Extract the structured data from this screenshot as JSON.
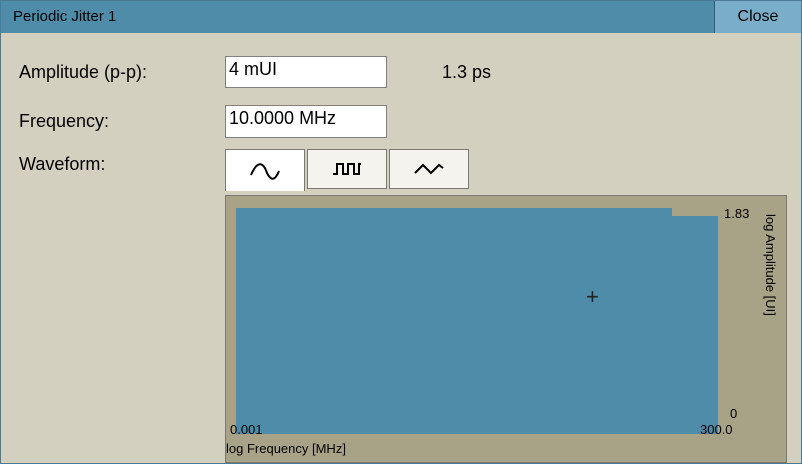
{
  "window": {
    "title": "Periodic Jitter 1",
    "close_label": "Close"
  },
  "fields": {
    "amplitude": {
      "label": "Amplitude (p-p):",
      "value": "4 mUI",
      "derived": "1.3 ps"
    },
    "frequency": {
      "label": "Frequency:",
      "value": "10.0000 MHz"
    }
  },
  "waveform": {
    "label": "Waveform:",
    "options": [
      {
        "name": "sine",
        "icon": "sine-wave-icon",
        "selected": true
      },
      {
        "name": "square",
        "icon": "square-wave-icon",
        "selected": false
      },
      {
        "name": "triangle",
        "icon": "triangle-wave-icon",
        "selected": false
      }
    ]
  },
  "plot": {
    "x_label": "log Frequency [MHz]",
    "y_label": "log Amplitude [UI]",
    "x_min_label": "0.001",
    "x_max_label": "300.0",
    "y_max_label": "1.83",
    "y_min_label": "0",
    "region_color": "#4e8caa",
    "frame_color": "#a8a286",
    "marker": "+"
  }
}
